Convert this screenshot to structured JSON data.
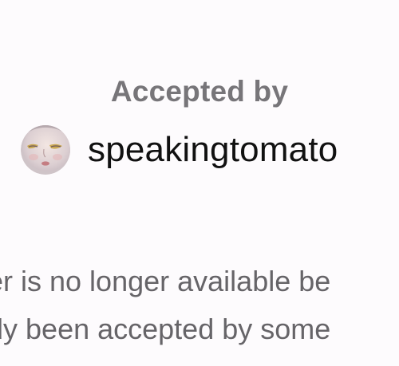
{
  "accepted": {
    "label": "Accepted by"
  },
  "user": {
    "username": "speakingtomato",
    "avatar_icon": "avatar-portrait"
  },
  "message": {
    "line1": "er is no longer available be",
    "line2": "dy been accepted by some"
  },
  "colors": {
    "background": "#fdfbfd",
    "label": "#777579",
    "username": "#111111",
    "message": "#666468"
  }
}
